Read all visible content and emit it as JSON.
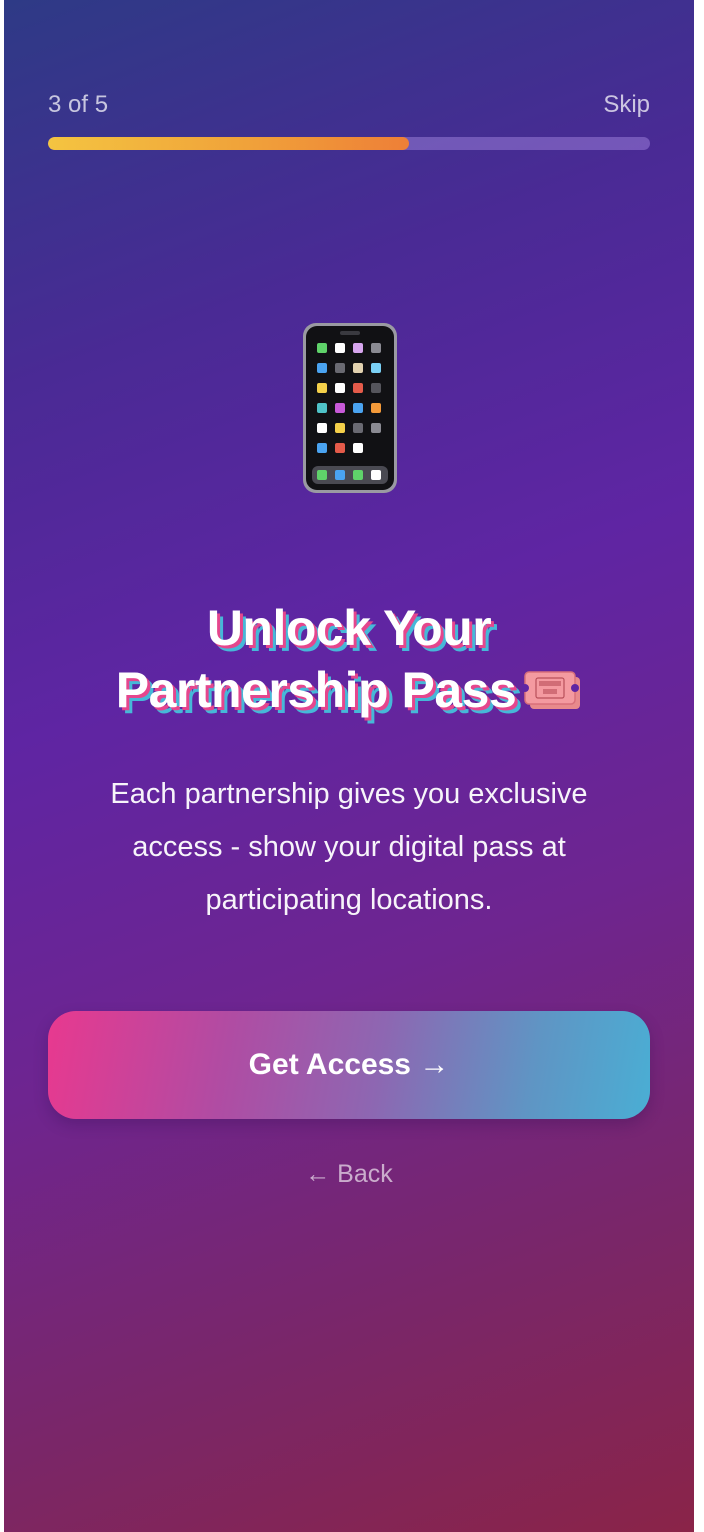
{
  "header": {
    "step_text": "3 of 5",
    "skip_label": "Skip"
  },
  "progress": {
    "fraction": 0.6
  },
  "hero": {
    "icon": "mobile-phone-icon"
  },
  "content": {
    "title_line1": "Unlock Your",
    "title_line2": "Partnership Pass",
    "title_icon": "admission-ticket-icon",
    "body": "Each partnership gives you exclusive access - show your digital pass at participating locations."
  },
  "actions": {
    "primary_label": "Get Access →",
    "back_label": "← Back"
  },
  "colors": {
    "progress_start": "#f4c441",
    "progress_end": "#ee7f37",
    "cta_start": "#e8398f",
    "cta_end": "#4aaed4",
    "title_shadow_pink": "#e5468d",
    "title_shadow_cyan": "#46b8d8"
  }
}
